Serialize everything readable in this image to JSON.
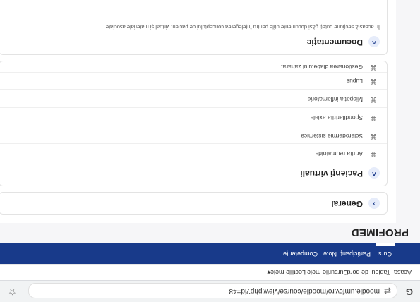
{
  "browser": {
    "url": "moodle.umfcv.ro/moodle/course/view.php?id=48",
    "bookmarks": [
      "Acasa",
      "Tabloul de bord",
      "Cursurile mele",
      "Lectiile mele"
    ]
  },
  "nav": {
    "tabs": [
      "Curs",
      "Participanți",
      "Note",
      "Competențe"
    ]
  },
  "brand": "PROFIMED",
  "sections": {
    "general": {
      "title": "General"
    },
    "virtual_patients": {
      "title": "Pacienți virtuali",
      "items": [
        "Artrita reumatoida",
        "Sclerodermie sistemica",
        "Spondilartrita axiala",
        "Miopatia inflamatorie",
        "Lupus",
        "Gestionarea diabetului zaharat"
      ]
    },
    "documentation": {
      "title": "Documentație",
      "description": "În această secțiune puteți găsi documente utile pentru înțelegerea conceptului de pacient virtual și materiale asociate"
    }
  }
}
